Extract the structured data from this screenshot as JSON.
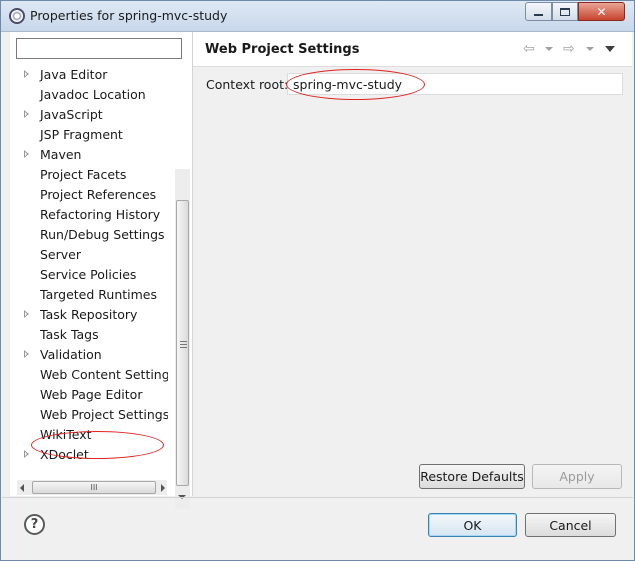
{
  "window": {
    "title": "Properties for spring-mvc-study",
    "close_glyph": "✕"
  },
  "filter": {
    "value": "",
    "placeholder": ""
  },
  "tree": {
    "items": [
      {
        "label": "Java Editor",
        "expandable": true
      },
      {
        "label": "Javadoc Location",
        "expandable": false
      },
      {
        "label": "JavaScript",
        "expandable": true
      },
      {
        "label": "JSP Fragment",
        "expandable": false
      },
      {
        "label": "Maven",
        "expandable": true
      },
      {
        "label": "Project Facets",
        "expandable": false
      },
      {
        "label": "Project References",
        "expandable": false
      },
      {
        "label": "Refactoring History",
        "expandable": false
      },
      {
        "label": "Run/Debug Settings",
        "expandable": false
      },
      {
        "label": "Server",
        "expandable": false
      },
      {
        "label": "Service Policies",
        "expandable": false
      },
      {
        "label": "Targeted Runtimes",
        "expandable": false
      },
      {
        "label": "Task Repository",
        "expandable": true
      },
      {
        "label": "Task Tags",
        "expandable": false
      },
      {
        "label": "Validation",
        "expandable": true
      },
      {
        "label": "Web Content Settings",
        "expandable": false
      },
      {
        "label": "Web Page Editor",
        "expandable": false
      },
      {
        "label": "Web Project Settings",
        "expandable": false,
        "selected": true
      },
      {
        "label": "WikiText",
        "expandable": false
      },
      {
        "label": "XDoclet",
        "expandable": true
      }
    ],
    "hscroll_grip": "III"
  },
  "page": {
    "title": "Web Project Settings",
    "back_glyph": "⇦",
    "forward_glyph": "⇨",
    "context_root_label": "Context root:",
    "context_root_value": "spring-mvc-study",
    "restore_defaults_label": "Restore Defaults",
    "apply_label": "Apply"
  },
  "footer": {
    "help_glyph": "?",
    "ok_label": "OK",
    "cancel_label": "Cancel"
  },
  "colors": {
    "annotation_red": "#e0231e",
    "ok_border": "#3c7fb1"
  }
}
